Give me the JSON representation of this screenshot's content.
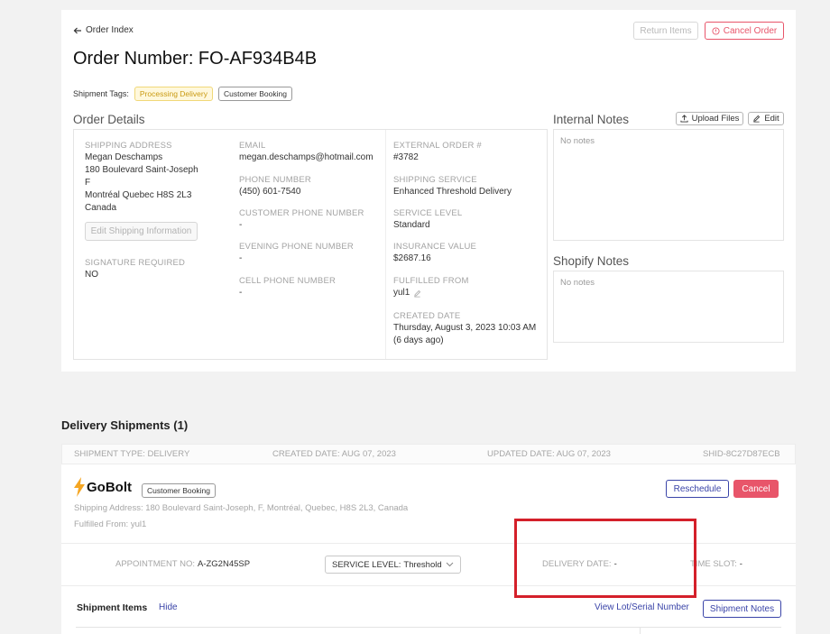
{
  "header": {
    "back_label": "Order Index",
    "title": "Order Number: FO-AF934B4B",
    "return_items_label": "Return Items",
    "cancel_order_label": "Cancel Order",
    "tags_label": "Shipment Tags:",
    "tags": [
      "Processing Delivery",
      "Customer Booking"
    ]
  },
  "order_details": {
    "title": "Order Details",
    "shipping_address_label": "SHIPPING ADDRESS",
    "address_lines": [
      "Megan Deschamps",
      "180 Boulevard Saint-Joseph",
      "F",
      "Montréal Quebec H8S 2L3",
      "Canada"
    ],
    "edit_shipping_label": "Edit Shipping Information",
    "signature_label": "SIGNATURE REQUIRED",
    "signature_value": "NO",
    "email_label": "EMAIL",
    "email_value": "megan.deschamps@hotmail.com",
    "phone_label": "PHONE NUMBER",
    "phone_value": "(450) 601-7540",
    "customer_phone_label": "CUSTOMER PHONE NUMBER",
    "customer_phone_value": "-",
    "evening_phone_label": "EVENING PHONE NUMBER",
    "evening_phone_value": "-",
    "cell_phone_label": "CELL PHONE NUMBER",
    "cell_phone_value": "-",
    "external_order_label": "EXTERNAL ORDER #",
    "external_order_value": "#3782",
    "shipping_service_label": "SHIPPING SERVICE",
    "shipping_service_value": "Enhanced Threshold Delivery",
    "service_level_label": "SERVICE LEVEL",
    "service_level_value": "Standard",
    "insurance_label": "INSURANCE VALUE",
    "insurance_value": "$2687.16",
    "fulfilled_label": "FULFILLED FROM",
    "fulfilled_value": "yul1",
    "created_label": "CREATED DATE",
    "created_value": "Thursday, August 3, 2023 10:03 AM",
    "created_relative": "(6 days ago)"
  },
  "internal_notes": {
    "title": "Internal Notes",
    "upload_label": "Upload Files",
    "edit_label": "Edit",
    "empty": "No notes"
  },
  "shopify_notes": {
    "title": "Shopify Notes",
    "empty": "No notes"
  },
  "delivery": {
    "title": "Delivery Shipments (1)",
    "shipment_type": "SHIPMENT TYPE: Delivery",
    "created_date": "CREATED DATE: Aug 07, 2023",
    "updated_date": "UPDATED DATE: Aug 07, 2023",
    "shid": "SHID-8C27D87ECB",
    "carrier": "GoBolt",
    "tag": "Customer Booking",
    "address": "Shipping Address: 180 Boulevard Saint-Joseph, F, Montréal, Quebec, H8S 2L3, Canada",
    "fulfilled_from": "Fulfilled From: yul1",
    "reschedule_label": "Reschedule",
    "cancel_label": "Cancel",
    "appointment_label": "APPOINTMENT NO:",
    "appointment_value": "A-ZG2N45SP",
    "service_level_label": "SERVICE LEVEL:",
    "service_level_value": "Threshold",
    "delivery_date_label": "DELIVERY DATE:",
    "delivery_date_value": "-",
    "time_slot_label": "TIME SLOT:",
    "time_slot_value": "-",
    "items_title": "Shipment Items",
    "hide_label": "Hide",
    "lot_label": "View Lot/Serial Number",
    "notes_label": "Shipment Notes"
  },
  "colors": {
    "danger": "#e8556a",
    "primary": "#3a44a8",
    "tag_yellow_bg": "#fff8dc",
    "tag_yellow_text": "#c99a12",
    "highlight": "#d4202a"
  }
}
